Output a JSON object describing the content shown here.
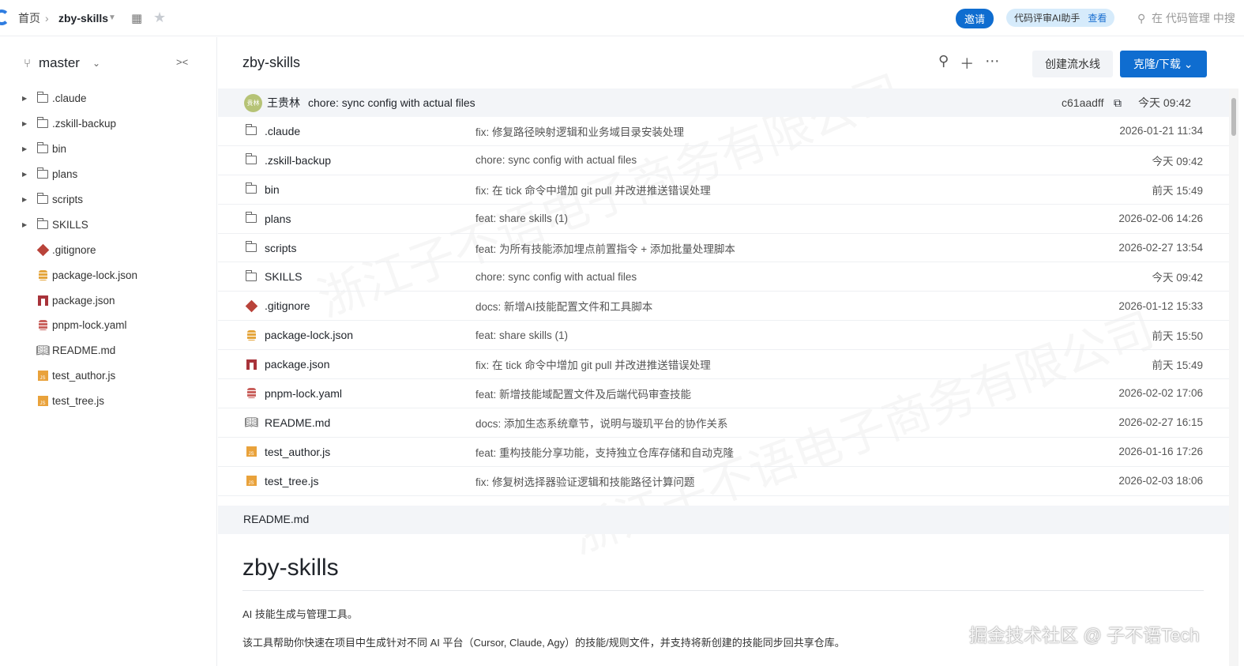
{
  "topbar": {
    "home": "首页",
    "repo": "zby-skills",
    "invite": "邀请",
    "ai_label": "代码评审AI助手",
    "ai_link": "查看",
    "search_placeholder": "在 代码管理 中搜"
  },
  "sidebar": {
    "branch": "master",
    "tree": [
      {
        "name": ".claude",
        "type": "folder"
      },
      {
        "name": ".zskill-backup",
        "type": "folder"
      },
      {
        "name": "bin",
        "type": "folder"
      },
      {
        "name": "plans",
        "type": "folder"
      },
      {
        "name": "scripts",
        "type": "folder"
      },
      {
        "name": "SKILLS",
        "type": "folder"
      },
      {
        "name": ".gitignore",
        "type": "git"
      },
      {
        "name": "package-lock.json",
        "type": "db"
      },
      {
        "name": "package.json",
        "type": "npm"
      },
      {
        "name": "pnpm-lock.yaml",
        "type": "dbred"
      },
      {
        "name": "README.md",
        "type": "book"
      },
      {
        "name": "test_author.js",
        "type": "js"
      },
      {
        "name": "test_tree.js",
        "type": "js"
      }
    ]
  },
  "main": {
    "title": "zby-skills",
    "create_pipeline": "创建流水线",
    "clone": "克隆/下载 ⌄",
    "commit": {
      "avatar": "贵林",
      "author": "王贵林",
      "message": "chore: sync config with actual files",
      "hash": "c61aadff",
      "time": "今天 09:42"
    },
    "files": [
      {
        "name": ".claude",
        "type": "folder",
        "msg": "fix: 修复路径映射逻辑和业务域目录安装处理",
        "date": "2026-01-21 11:34"
      },
      {
        "name": ".zskill-backup",
        "type": "folder",
        "msg": "chore: sync config with actual files",
        "date": "今天 09:42"
      },
      {
        "name": "bin",
        "type": "folder",
        "msg": "fix: 在 tick 命令中增加 git pull 并改进推送错误处理",
        "date": "前天 15:49"
      },
      {
        "name": "plans",
        "type": "folder",
        "msg": "feat: share skills (1)",
        "date": "2026-02-06 14:26"
      },
      {
        "name": "scripts",
        "type": "folder",
        "msg": "feat: 为所有技能添加埋点前置指令 + 添加批量处理脚本",
        "date": "2026-02-27 13:54"
      },
      {
        "name": "SKILLS",
        "type": "folder",
        "msg": "chore: sync config with actual files",
        "date": "今天 09:42"
      },
      {
        "name": ".gitignore",
        "type": "git",
        "msg": "docs: 新增AI技能配置文件和工具脚本",
        "date": "2026-01-12 15:33"
      },
      {
        "name": "package-lock.json",
        "type": "db",
        "msg": "feat: share skills (1)",
        "date": "前天 15:50"
      },
      {
        "name": "package.json",
        "type": "npm",
        "msg": "fix: 在 tick 命令中增加 git pull 并改进推送错误处理",
        "date": "前天 15:49"
      },
      {
        "name": "pnpm-lock.yaml",
        "type": "dbred",
        "msg": "feat: 新增技能域配置文件及后端代码审查技能",
        "date": "2026-02-02 17:06"
      },
      {
        "name": "README.md",
        "type": "book",
        "msg": "docs: 添加生态系统章节，说明与璇玑平台的协作关系",
        "date": "2026-02-27 16:15"
      },
      {
        "name": "test_author.js",
        "type": "js",
        "msg": "feat: 重构技能分享功能，支持独立仓库存储和自动克隆",
        "date": "2026-01-16 17:26"
      },
      {
        "name": "test_tree.js",
        "type": "js",
        "msg": "fix: 修复树选择器验证逻辑和技能路径计算问题",
        "date": "2026-02-03 18:06"
      }
    ],
    "readme": {
      "header": "README.md",
      "title": "zby-skills",
      "p1": "AI 技能生成与管理工具。",
      "p2": "该工具帮助你快速在项目中生成针对不同 AI 平台（Cursor, Claude, Agy）的技能/规则文件，并支持将新创建的技能同步回共享仓库。"
    }
  },
  "watermark": {
    "corner": "掘金技术社区 @ 子不语Tech",
    "background": "浙江子不语电子商务有限公司"
  }
}
